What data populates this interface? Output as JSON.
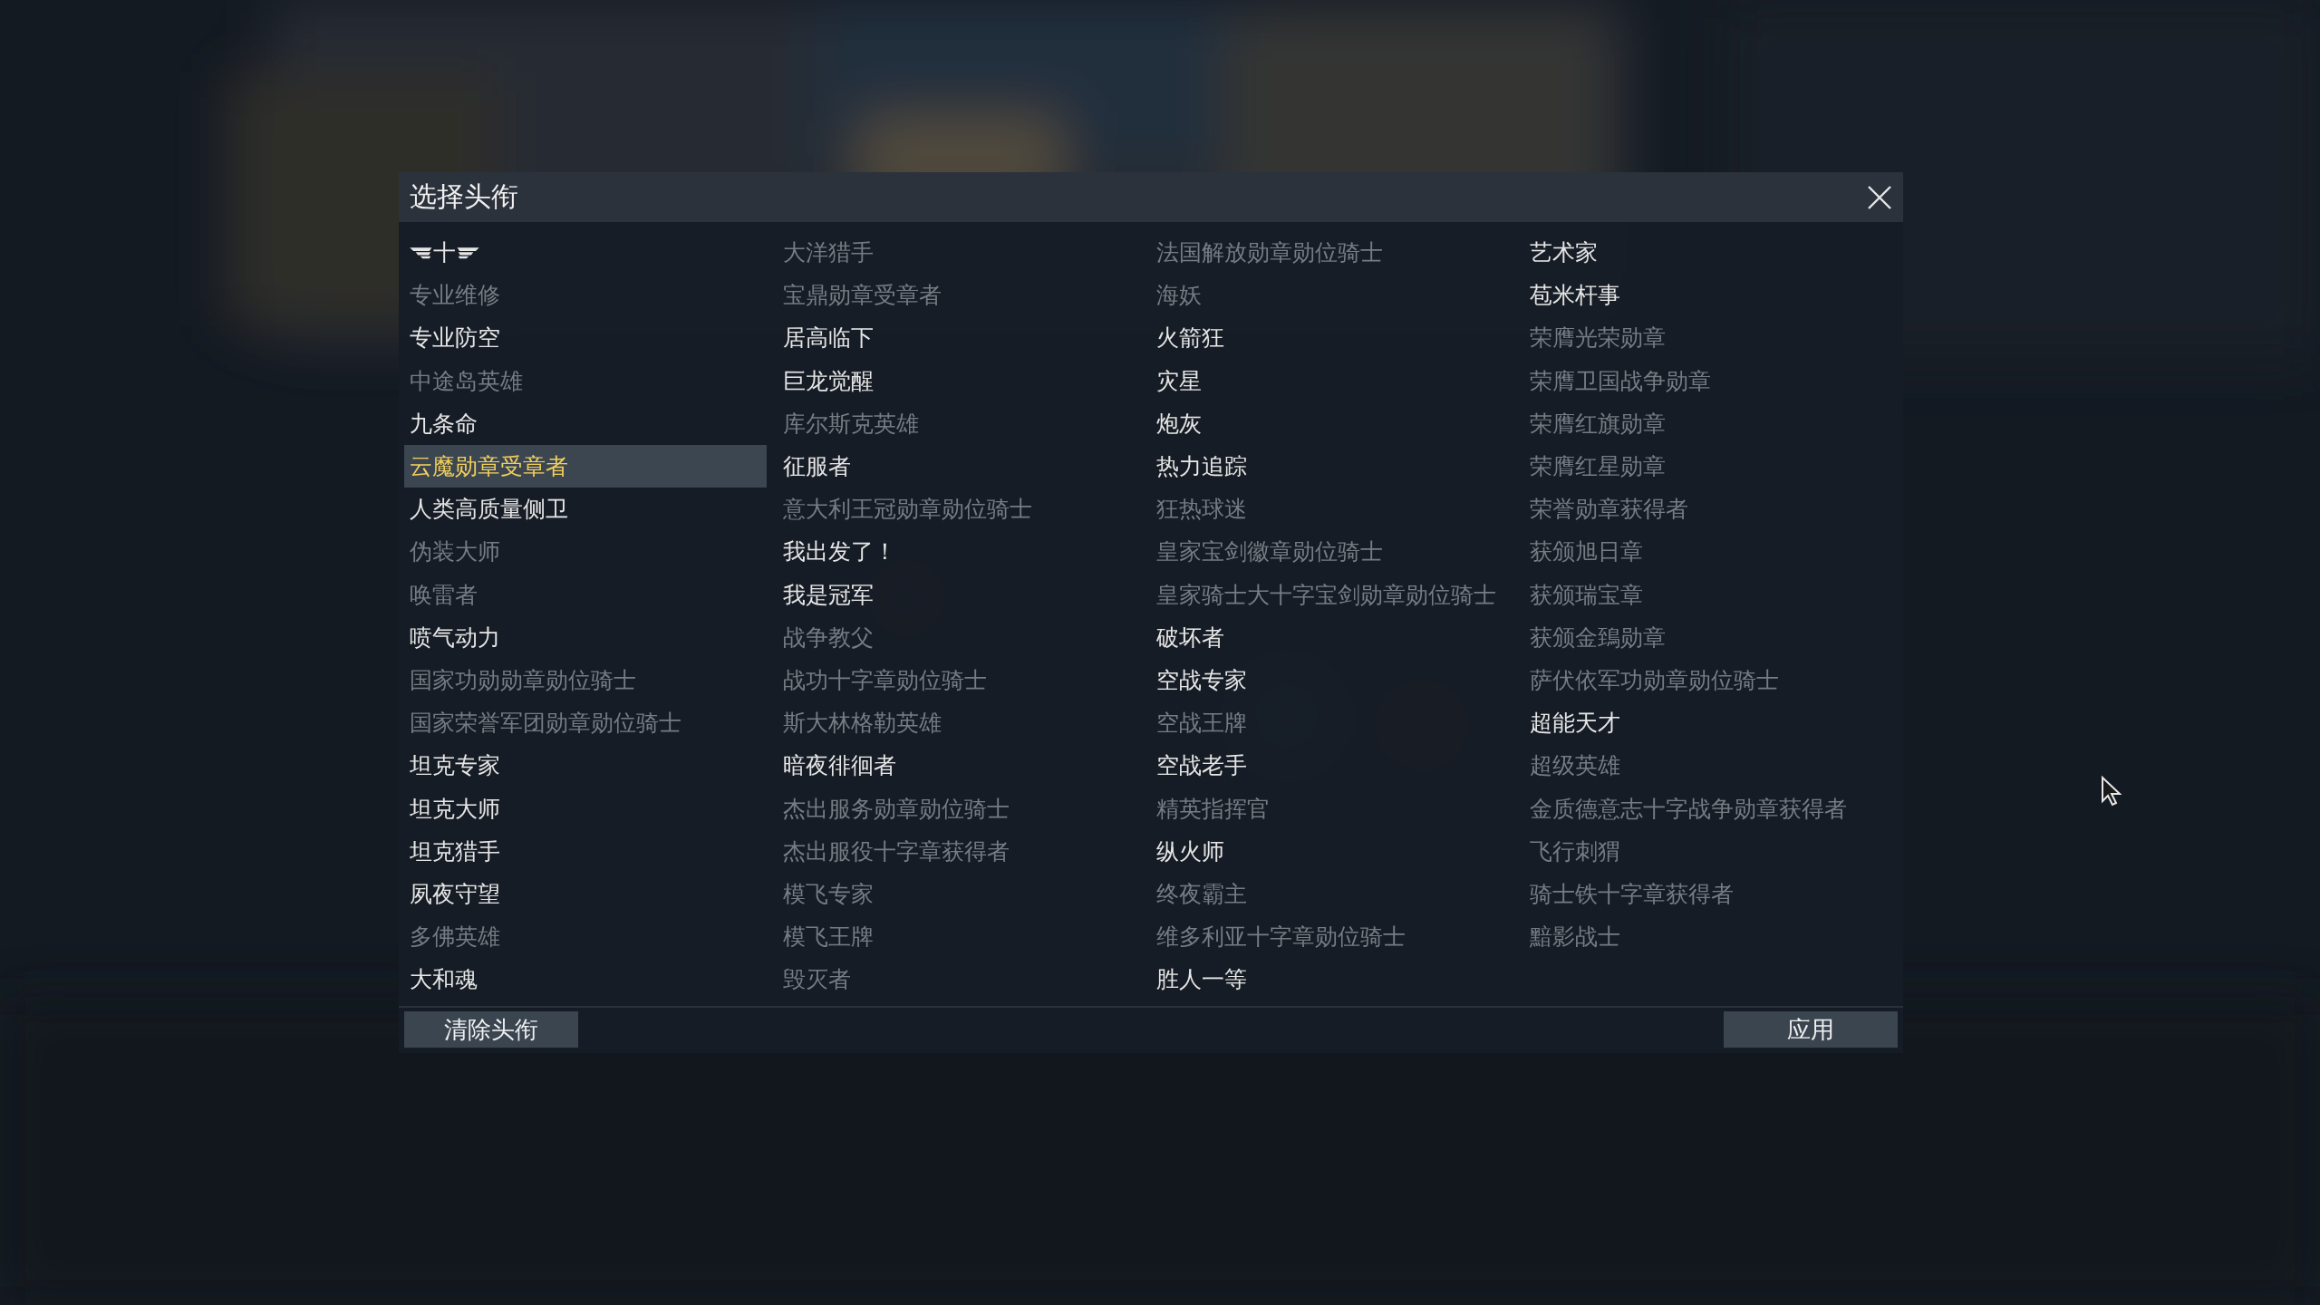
{
  "dialog": {
    "title": "选择头衔",
    "columns": [
      [
        {
          "label": "十",
          "kind": "emblem",
          "available": true,
          "selected": false
        },
        {
          "label": "专业维修",
          "available": false,
          "selected": false
        },
        {
          "label": "专业防空",
          "available": true,
          "selected": false
        },
        {
          "label": "中途岛英雄",
          "available": false,
          "selected": false
        },
        {
          "label": "九条命",
          "available": true,
          "selected": false
        },
        {
          "label": "云魔勋章受章者",
          "available": true,
          "selected": true
        },
        {
          "label": "人类高质量侧卫",
          "available": true,
          "selected": false
        },
        {
          "label": "伪装大师",
          "available": false,
          "selected": false
        },
        {
          "label": "唤雷者",
          "available": false,
          "selected": false
        },
        {
          "label": "喷气动力",
          "available": true,
          "selected": false
        },
        {
          "label": "国家功勋勋章勋位骑士",
          "available": false,
          "selected": false
        },
        {
          "label": "国家荣誉军团勋章勋位骑士",
          "available": false,
          "selected": false
        },
        {
          "label": "坦克专家",
          "available": true,
          "selected": false
        },
        {
          "label": "坦克大师",
          "available": true,
          "selected": false
        },
        {
          "label": "坦克猎手",
          "available": true,
          "selected": false
        },
        {
          "label": "夙夜守望",
          "available": true,
          "selected": false
        },
        {
          "label": "多佛英雄",
          "available": false,
          "selected": false
        },
        {
          "label": "大和魂",
          "available": true,
          "selected": false
        }
      ],
      [
        {
          "label": "大洋猎手",
          "available": false,
          "selected": false
        },
        {
          "label": "宝鼎勋章受章者",
          "available": false,
          "selected": false
        },
        {
          "label": "居高临下",
          "available": true,
          "selected": false
        },
        {
          "label": "巨龙觉醒",
          "available": true,
          "selected": false
        },
        {
          "label": "库尔斯克英雄",
          "available": false,
          "selected": false
        },
        {
          "label": "征服者",
          "available": true,
          "selected": false
        },
        {
          "label": "意大利王冠勋章勋位骑士",
          "available": false,
          "selected": false
        },
        {
          "label": "我出发了！",
          "available": true,
          "selected": false
        },
        {
          "label": "我是冠军",
          "available": true,
          "selected": false
        },
        {
          "label": "战争教父",
          "available": false,
          "selected": false
        },
        {
          "label": "战功十字章勋位骑士",
          "available": false,
          "selected": false
        },
        {
          "label": "斯大林格勒英雄",
          "available": false,
          "selected": false
        },
        {
          "label": "暗夜徘徊者",
          "available": true,
          "selected": false
        },
        {
          "label": "杰出服务勋章勋位骑士",
          "available": false,
          "selected": false
        },
        {
          "label": "杰出服役十字章获得者",
          "available": false,
          "selected": false
        },
        {
          "label": "模飞专家",
          "available": false,
          "selected": false
        },
        {
          "label": "模飞王牌",
          "available": false,
          "selected": false
        },
        {
          "label": "毁灭者",
          "available": false,
          "selected": false
        }
      ],
      [
        {
          "label": "法国解放勋章勋位骑士",
          "available": false,
          "selected": false
        },
        {
          "label": "海妖",
          "available": false,
          "selected": false
        },
        {
          "label": "火箭狂",
          "available": true,
          "selected": false
        },
        {
          "label": "灾星",
          "available": true,
          "selected": false
        },
        {
          "label": "炮灰",
          "available": true,
          "selected": false
        },
        {
          "label": "热力追踪",
          "available": true,
          "selected": false
        },
        {
          "label": "狂热球迷",
          "available": false,
          "selected": false
        },
        {
          "label": "皇家宝剑徽章勋位骑士",
          "available": false,
          "selected": false
        },
        {
          "label": "皇家骑士大十字宝剑勋章勋位骑士",
          "available": false,
          "selected": false
        },
        {
          "label": "破坏者",
          "available": true,
          "selected": false
        },
        {
          "label": "空战专家",
          "available": true,
          "selected": false
        },
        {
          "label": "空战王牌",
          "available": false,
          "selected": false
        },
        {
          "label": "空战老手",
          "available": true,
          "selected": false
        },
        {
          "label": "精英指挥官",
          "available": false,
          "selected": false
        },
        {
          "label": "纵火师",
          "available": true,
          "selected": false
        },
        {
          "label": "终夜霸主",
          "available": false,
          "selected": false
        },
        {
          "label": "维多利亚十字章勋位骑士",
          "available": false,
          "selected": false
        },
        {
          "label": "胜人一等",
          "available": true,
          "selected": false
        }
      ],
      [
        {
          "label": "艺术家",
          "available": true,
          "selected": false
        },
        {
          "label": "苞米杆事",
          "available": true,
          "selected": false
        },
        {
          "label": "荣膺光荣勋章",
          "available": false,
          "selected": false
        },
        {
          "label": "荣膺卫国战争勋章",
          "available": false,
          "selected": false
        },
        {
          "label": "荣膺红旗勋章",
          "available": false,
          "selected": false
        },
        {
          "label": "荣膺红星勋章",
          "available": false,
          "selected": false
        },
        {
          "label": "荣誉勋章获得者",
          "available": false,
          "selected": false
        },
        {
          "label": "获颁旭日章",
          "available": false,
          "selected": false
        },
        {
          "label": "获颁瑞宝章",
          "available": false,
          "selected": false
        },
        {
          "label": "获颁金鵄勋章",
          "available": false,
          "selected": false
        },
        {
          "label": "萨伏依军功勋章勋位骑士",
          "available": false,
          "selected": false
        },
        {
          "label": "超能天才",
          "available": true,
          "selected": false
        },
        {
          "label": "超级英雄",
          "available": false,
          "selected": false
        },
        {
          "label": "金质德意志十字战争勋章获得者",
          "available": false,
          "selected": false
        },
        {
          "label": "飞行刺猬",
          "available": false,
          "selected": false
        },
        {
          "label": "骑士铁十字章获得者",
          "available": false,
          "selected": false
        },
        {
          "label": "黯影战士",
          "available": false,
          "selected": false
        }
      ]
    ],
    "clear_button": "清除头衔",
    "apply_button": "应用"
  }
}
